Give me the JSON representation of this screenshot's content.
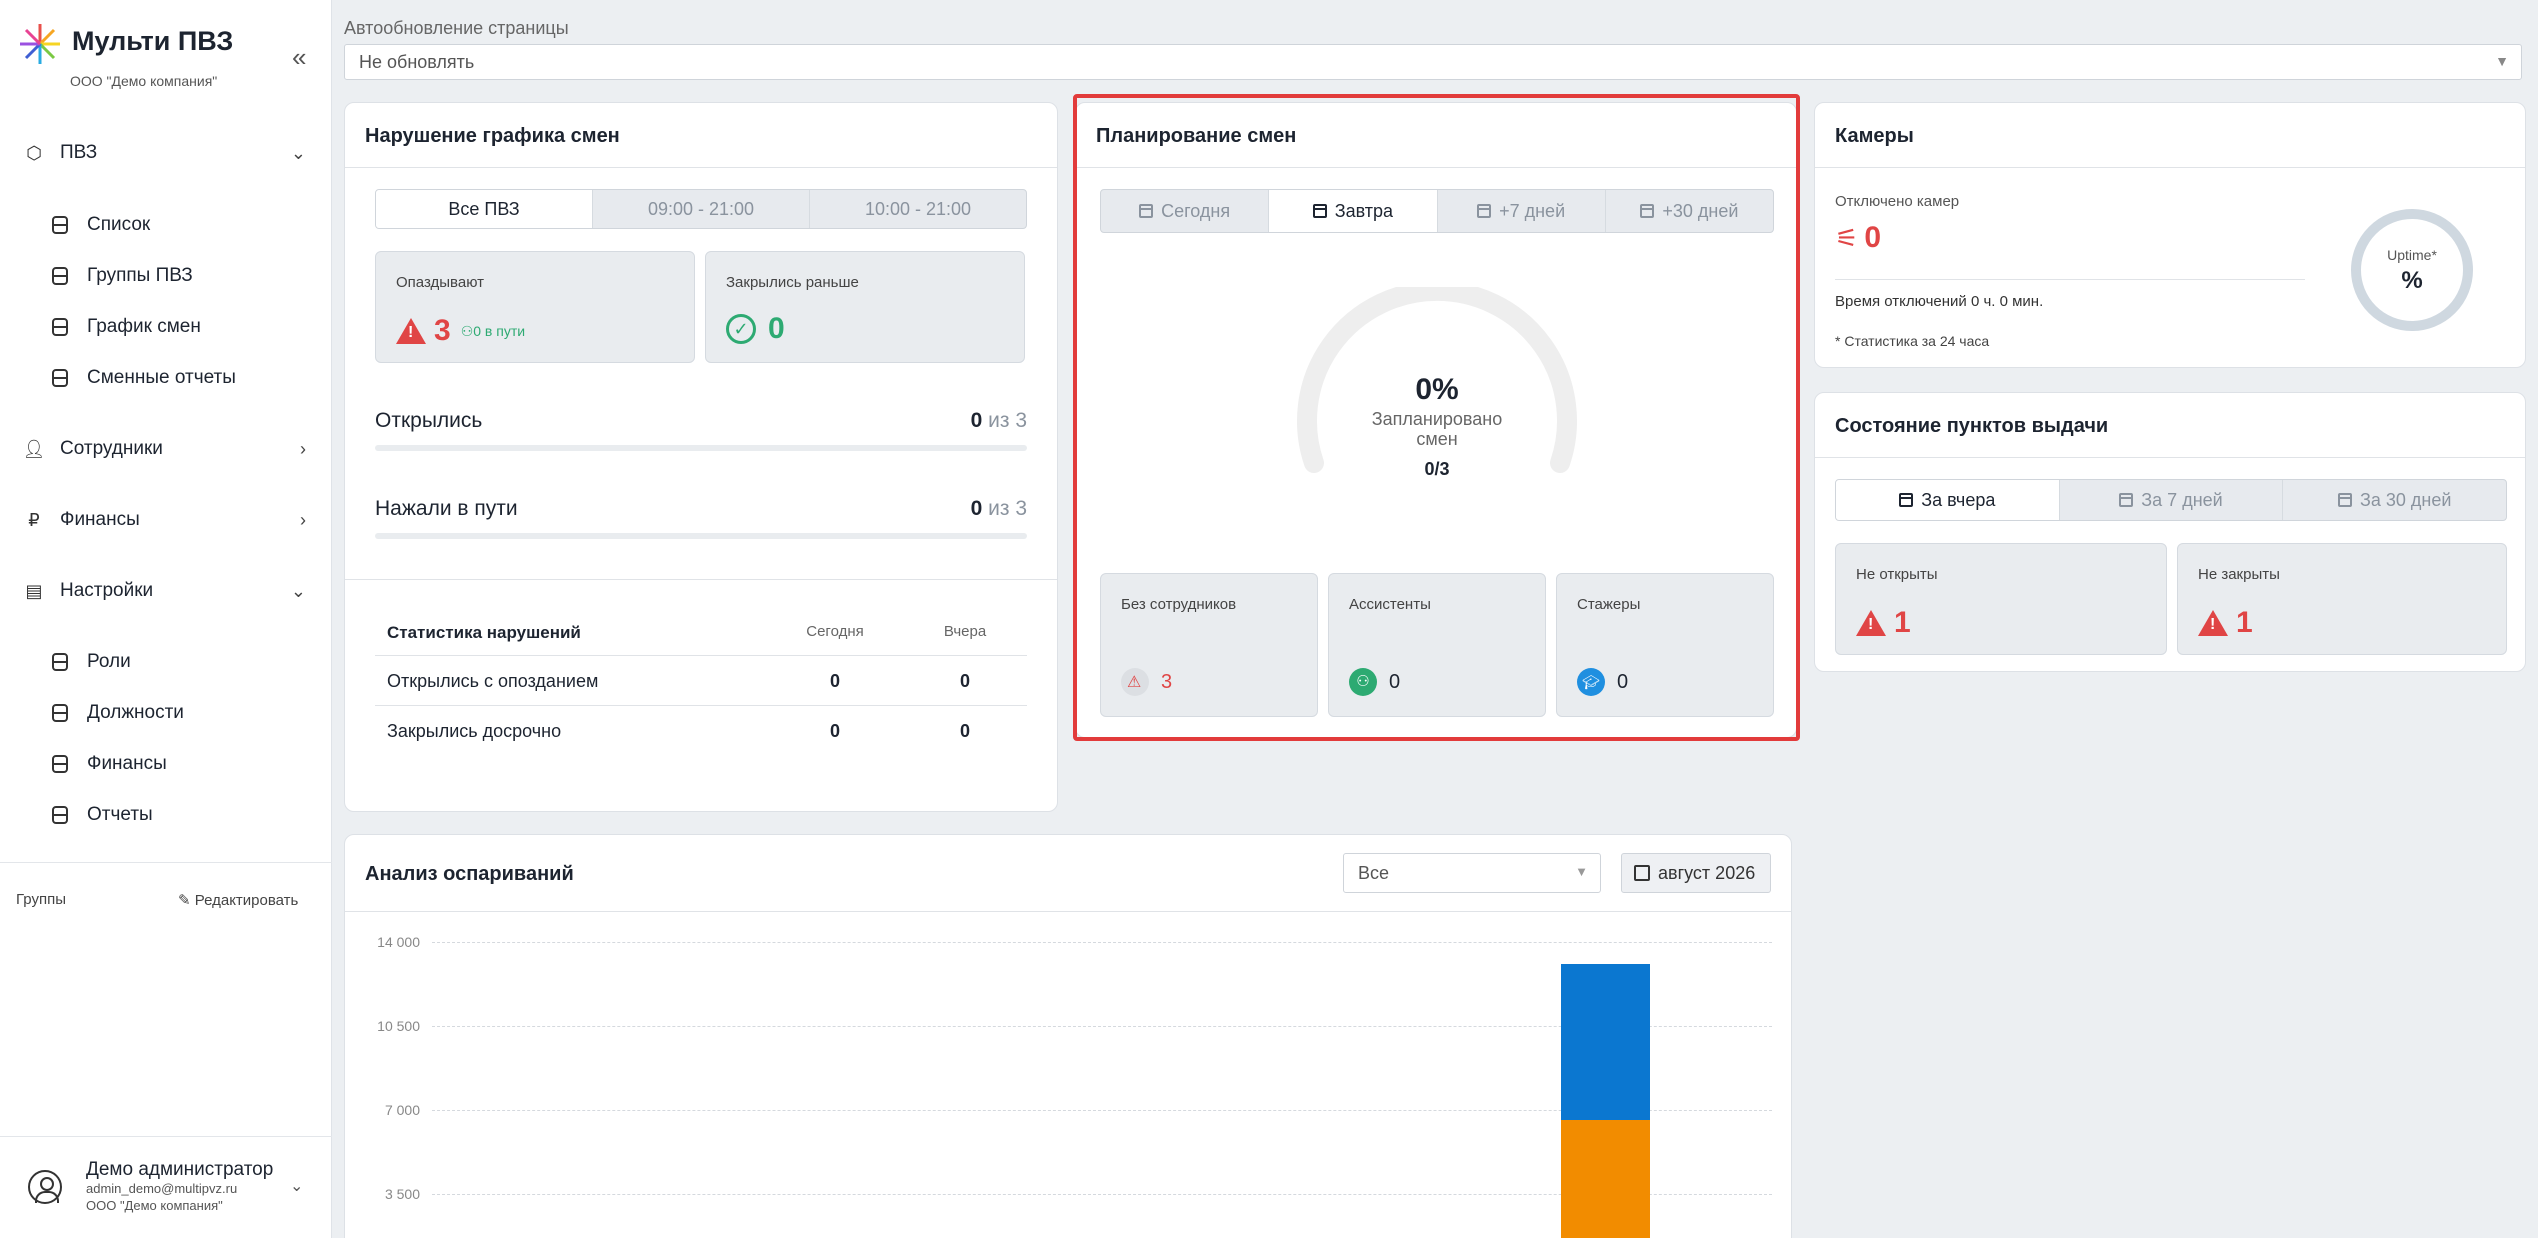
{
  "app": {
    "title": "Мульти ПВЗ",
    "company": "ООО \"Демо компания\""
  },
  "sidebar": {
    "items": [
      {
        "label": "ПВЗ",
        "chevron": "⌄"
      },
      {
        "label": "Список"
      },
      {
        "label": "Группы ПВЗ"
      },
      {
        "label": "График смен"
      },
      {
        "label": "Сменные отчеты"
      },
      {
        "label": "Сотрудники",
        "chevron": "›"
      },
      {
        "label": "Финансы",
        "chevron": "›"
      },
      {
        "label": "Настройки",
        "chevron": "⌄"
      },
      {
        "label": "Роли"
      },
      {
        "label": "Должности"
      },
      {
        "label": "Финансы"
      },
      {
        "label": "Отчеты"
      }
    ],
    "groups_label": "Группы",
    "edit_label": "Редактировать"
  },
  "user": {
    "name": "Демо администратор",
    "email": "admin_demo@multipvz.ru",
    "org": "ООО \"Демо компания\""
  },
  "autorefresh": {
    "label": "Автообновление страницы",
    "value": "Не обновлять"
  },
  "violations": {
    "title": "Нарушение графика смен",
    "tabs": [
      "Все ПВЗ",
      "09:00 - 21:00",
      "10:00 - 21:00"
    ],
    "late_label": "Опаздывают",
    "late_value": "3",
    "late_on_way": "0 в пути",
    "closed_early_label": "Закрылись раньше",
    "closed_early_value": "0",
    "opened_label": "Открылись",
    "opened_value": "0",
    "opened_total": "из 3",
    "pressed_label": "Нажали в пути",
    "pressed_value": "0",
    "pressed_total": "из 3",
    "stats_title": "Статистика нарушений",
    "col_today": "Сегодня",
    "col_yesterday": "Вчера",
    "rows": [
      {
        "label": "Открылись с опозданием",
        "today": "0",
        "yesterday": "0"
      },
      {
        "label": "Закрылись досрочно",
        "today": "0",
        "yesterday": "0"
      }
    ]
  },
  "planning": {
    "title": "Планирование смен",
    "tabs": [
      "Сегодня",
      "Завтра",
      "+7 дней",
      "+30 дней"
    ],
    "percent": "0%",
    "planned_label": "Запланировано смен",
    "ratio": "0/3",
    "gauge_fraction": 0,
    "tiles": [
      {
        "label": "Без сотрудников",
        "value": "3"
      },
      {
        "label": "Ассистенты",
        "value": "0"
      },
      {
        "label": "Стажеры",
        "value": "0"
      }
    ]
  },
  "cameras": {
    "title": "Камеры",
    "disabled_label": "Отключено камер",
    "disabled_value": "0",
    "downtime": "Время отключений 0 ч. 0 мин.",
    "note": "* Статистика за 24 часа",
    "uptime_label": "Uptime*",
    "uptime_value": "%"
  },
  "points": {
    "title": "Состояние пунктов выдачи",
    "tabs": [
      "За вчера",
      "За 7 дней",
      "За 30 дней"
    ],
    "not_opened_label": "Не открыты",
    "not_opened_value": "1",
    "not_closed_label": "Не закрыты",
    "not_closed_value": "1"
  },
  "disputes": {
    "title": "Анализ оспариваний",
    "filter_value": "Все",
    "date_value": "август 2026"
  },
  "chart_data": {
    "type": "bar",
    "title": "",
    "ylim": [
      0,
      14000
    ],
    "yticks": [
      "14 000",
      "10 500",
      "7 000",
      "3 500"
    ],
    "stacked": true,
    "series": [
      {
        "color": "#f28c00",
        "values": [
          6600
        ]
      },
      {
        "color": "#0b77d0",
        "values": [
          6500
        ]
      }
    ]
  },
  "colors": {
    "accent_red": "#e04545",
    "accent_green": "#2daa72",
    "highlight": "#e23b3b",
    "bar_blue": "#0b77d0",
    "bar_orange": "#f28c00"
  }
}
